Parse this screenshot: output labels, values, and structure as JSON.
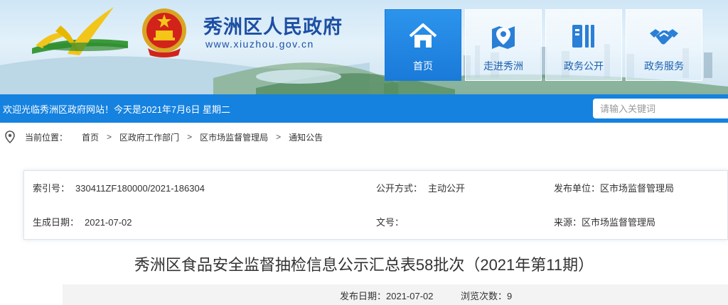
{
  "site": {
    "title": "秀洲区人民政府",
    "url": "www.xiuzhou.gov.cn"
  },
  "nav": {
    "items": [
      {
        "label": "首页",
        "icon": "home-icon",
        "active": true
      },
      {
        "label": "走进秀洲",
        "icon": "map-pin-icon",
        "active": false
      },
      {
        "label": "政务公开",
        "icon": "book-icon",
        "active": false
      },
      {
        "label": "政务服务",
        "icon": "handshake-icon",
        "active": false
      }
    ]
  },
  "welcome": {
    "text": "欢迎光临秀洲区政府网站！今天是2021年7月6日 星期二",
    "search_placeholder": "请输入关键词"
  },
  "breadcrumb": {
    "label": "当前位置：",
    "items": [
      "首页",
      "区政府工作部门",
      "区市场监督管理局",
      "通知公告"
    ],
    "separator": ">"
  },
  "meta": {
    "index_key": "索引号：",
    "index_value": "330411ZF180000/2021-186304",
    "open_key": "公开方式：",
    "open_value": "主动公开",
    "publisher_key": "发布单位：",
    "publisher_value": "区市场监督管理局",
    "created_key": "生成日期：",
    "created_value": "2021-07-02",
    "docno_key": "文号：",
    "docno_value": "",
    "source_key": "来源：",
    "source_value": "区市场监督管理局"
  },
  "article": {
    "title": "秀洲区食品安全监督抽检信息公示汇总表58批次（2021年第11期）",
    "date_key": "发布日期：",
    "date_value": "2021-07-02",
    "views_key": "浏览次数：",
    "views_value": "9"
  },
  "colors": {
    "primary_blue": "#1582e0",
    "title_blue": "#1d4fa3",
    "nav_active": "#2c94ec"
  }
}
